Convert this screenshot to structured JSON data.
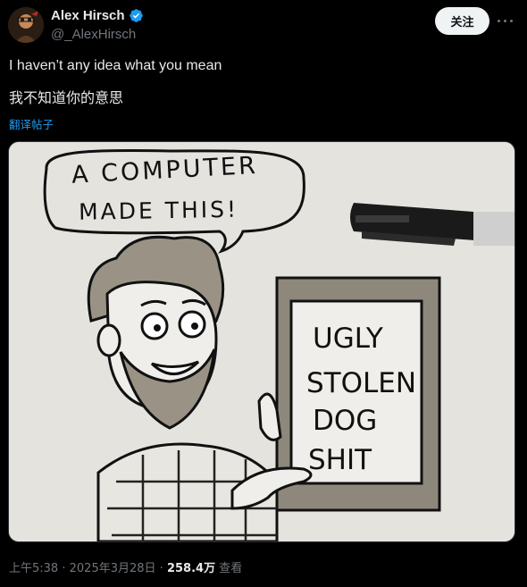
{
  "author": {
    "name": "Alex Hirsch",
    "handle": "@_AlexHirsch",
    "verified": true,
    "avatar_icon": "avatar-portrait"
  },
  "actions": {
    "follow_label": "关注",
    "more_icon": "more-horizontal-icon"
  },
  "post": {
    "text": "I haven’t any idea what you mean",
    "translation": "我不知道你的意思",
    "translate_link": "翻译帖子"
  },
  "image": {
    "speech_line1": "A COMPUTER",
    "speech_line2": "MADE THIS!",
    "sign_line1": "UGLY",
    "sign_line2": "STOLEN",
    "sign_line3": "DOG",
    "sign_line4": "SHIT"
  },
  "meta": {
    "time": "上午5:38",
    "separator": "·",
    "date": "2025年3月28日",
    "views": "258.4万",
    "views_label": "查看"
  },
  "colors": {
    "background": "#000000",
    "accent": "#1d9bf0",
    "secondary_text": "#71767b",
    "primary_text": "#e7e9ea"
  }
}
